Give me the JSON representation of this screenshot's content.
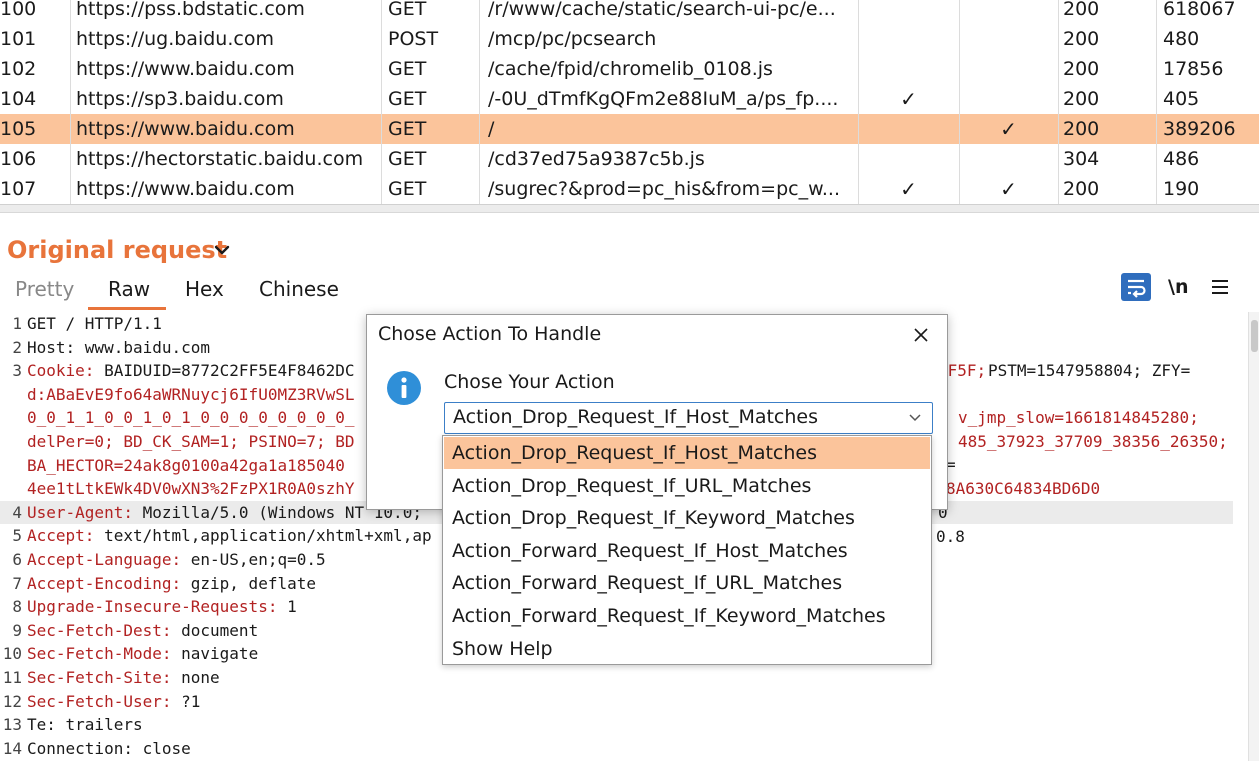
{
  "history": {
    "rows": [
      {
        "num": "100",
        "host": "https://pss.bdstatic.com",
        "method": "GET",
        "path": "/r/www/cache/static/search-ui-pc/e...",
        "check1": "",
        "check2": "",
        "status": "200",
        "length": "618067",
        "selected": false
      },
      {
        "num": "101",
        "host": "https://ug.baidu.com",
        "method": "POST",
        "path": "/mcp/pc/pcsearch",
        "check1": "",
        "check2": "",
        "status": "200",
        "length": "480",
        "selected": false
      },
      {
        "num": "102",
        "host": "https://www.baidu.com",
        "method": "GET",
        "path": "/cache/fpid/chromelib_0108.js",
        "check1": "",
        "check2": "",
        "status": "200",
        "length": "17856",
        "selected": false
      },
      {
        "num": "104",
        "host": "https://sp3.baidu.com",
        "method": "GET",
        "path": "/-0U_dTmfKgQFm2e88IuM_a/ps_fp....",
        "check1": "✓",
        "check2": "",
        "status": "200",
        "length": "405",
        "selected": false
      },
      {
        "num": "105",
        "host": "https://www.baidu.com",
        "method": "GET",
        "path": "/",
        "check1": "",
        "check2": "✓",
        "status": "200",
        "length": "389206",
        "selected": true
      },
      {
        "num": "106",
        "host": "https://hectorstatic.baidu.com",
        "method": "GET",
        "path": "/cd37ed75a9387c5b.js",
        "check1": "",
        "check2": "",
        "status": "304",
        "length": "486",
        "selected": false
      },
      {
        "num": "107",
        "host": "https://www.baidu.com",
        "method": "GET",
        "path": "/sugrec?&prod=pc_his&from=pc_w...",
        "check1": "✓",
        "check2": "✓",
        "status": "200",
        "length": "190",
        "selected": false
      }
    ]
  },
  "request_panel": {
    "title": "Original request",
    "tabs": [
      {
        "label": "Pretty",
        "active": false
      },
      {
        "label": "Raw",
        "active": true
      },
      {
        "label": "Hex",
        "active": false
      },
      {
        "label": "Chinese",
        "active": false
      }
    ],
    "newline_label": "\\n",
    "lines": [
      {
        "num": "1",
        "key": "",
        "text": "GET / HTTP/1.1"
      },
      {
        "num": "2",
        "key": "",
        "text": "Host: www.baidu.com"
      },
      {
        "num": "3",
        "key": "Cookie:",
        "text": " BAIDUID=8772C2FF5E4F8462DC"
      },
      {
        "num": "",
        "key": "d:ABaEvE9fo64aWRNuycj6IfU0MZ3RVwSL",
        "text": ""
      },
      {
        "num": "",
        "key": "0_0_1_1_0_0_1_0_1_0_0_0_0_0_0_0_0_",
        "text": ""
      },
      {
        "num": "",
        "key": "delPer=0; BD_CK_SAM=1; PSINO=7; BD",
        "text": ""
      },
      {
        "num": "",
        "key": " BA_HECTOR=24ak8g0100a42ga1a185040",
        "text": ""
      },
      {
        "num": "",
        "key": "4ee1tLtkEWk4DV0wXN3%2FzPX1R0A0szhY",
        "text": ""
      },
      {
        "num": "4",
        "key": "User-Agent:",
        "text": " Mozilla/5.0 (Windows NT 10.0;"
      },
      {
        "num": "5",
        "key": "Accept:",
        "text": " text/html,application/xhtml+xml,ap"
      },
      {
        "num": "6",
        "key": "Accept-Language:",
        "text": " en-US,en;q=0.5"
      },
      {
        "num": "7",
        "key": "Accept-Encoding:",
        "text": " gzip, deflate"
      },
      {
        "num": "8",
        "key": "Upgrade-Insecure-Requests:",
        "text": " 1"
      },
      {
        "num": "9",
        "key": "Sec-Fetch-Dest:",
        "text": " document"
      },
      {
        "num": "10",
        "key": "Sec-Fetch-Mode:",
        "text": " navigate"
      },
      {
        "num": "11",
        "key": "Sec-Fetch-Site:",
        "text": " none"
      },
      {
        "num": "12",
        "key": "Sec-Fetch-User:",
        "text": " ?1"
      },
      {
        "num": "13",
        "key": "",
        "text": "Te: trailers"
      },
      {
        "num": "14",
        "key": "",
        "text": "Connection: close"
      }
    ],
    "right_fragments": {
      "line3_right_a": "5F5F;",
      "line3_right_b": " PSTM=1547958804; ZFY=",
      "line3c_right": "v_jmp_slow=1661814845280;",
      "line3d_right": "485_37923_37709_38356_26350;",
      "line3e_right": "=",
      "line3f_right": "8A630C64834BD6D0",
      "line4_right": "0",
      "line5_right": "0.8"
    }
  },
  "dialog": {
    "title": "Chose Action To Handle",
    "prompt": "Chose Your Action",
    "selected_value": "Action_Drop_Request_If_Host_Matches",
    "options": [
      "Action_Drop_Request_If_Host_Matches",
      "Action_Drop_Request_If_URL_Matches",
      "Action_Drop_Request_If_Keyword_Matches",
      "Action_Forward_Request_If_Host_Matches",
      "Action_Forward_Request_If_URL_Matches",
      "Action_Forward_Request_If_Keyword_Matches",
      "Show Help"
    ],
    "highlighted_index": 0
  },
  "colors": {
    "accent": "#e8743b",
    "selection": "#fbc49b",
    "header_key": "#b22222",
    "info_icon": "#2f8fd8",
    "wrap_button": "#2f6dbd"
  }
}
